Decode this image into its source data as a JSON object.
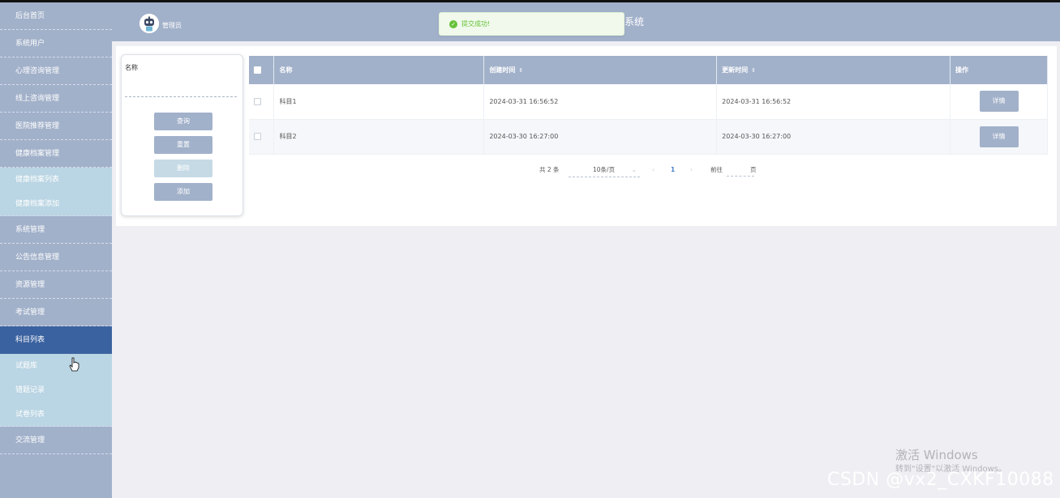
{
  "sidebar": {
    "items": [
      {
        "label": "后台首页",
        "type": "item"
      },
      {
        "label": "系统用户",
        "type": "item"
      },
      {
        "label": "心理咨询管理",
        "type": "item"
      },
      {
        "label": "线上咨询管理",
        "type": "item"
      },
      {
        "label": "医院推荐管理",
        "type": "item"
      },
      {
        "label": "健康档案管理",
        "type": "item"
      },
      {
        "label": "健康档案列表",
        "type": "sub"
      },
      {
        "label": "健康档案添加",
        "type": "sub"
      },
      {
        "label": "系统管理",
        "type": "item"
      },
      {
        "label": "公告信息管理",
        "type": "item"
      },
      {
        "label": "资源管理",
        "type": "item"
      },
      {
        "label": "考试管理",
        "type": "item"
      },
      {
        "label": "科目列表",
        "type": "active"
      },
      {
        "label": "试题库",
        "type": "sub"
      },
      {
        "label": "错题记录",
        "type": "sub"
      },
      {
        "label": "试卷列表",
        "type": "sub"
      },
      {
        "label": "交流管理",
        "type": "item"
      }
    ]
  },
  "header": {
    "admin_label": "管理员",
    "title_visible": "系统"
  },
  "toast": {
    "message": "提交成功!",
    "color": "#67c23a"
  },
  "search": {
    "name_label": "名称",
    "name_value": "",
    "buttons": {
      "query": "查询",
      "reset": "重置",
      "delete": "删除",
      "add": "添加"
    }
  },
  "table": {
    "headers": {
      "name": "名称",
      "created": "创建时间",
      "updated": "更新时间",
      "actions": "操作"
    },
    "rows": [
      {
        "name": "科目1",
        "created": "2024-03-31 16:56:52",
        "updated": "2024-03-31 16:56:52",
        "action": "详情"
      },
      {
        "name": "科目2",
        "created": "2024-03-30 16:27:00",
        "updated": "2024-03-30 16:27:00",
        "action": "详情"
      }
    ]
  },
  "pagination": {
    "total": "共 2 条",
    "page_size": "10条/页",
    "current_page": "1",
    "goto_label": "前往",
    "page_unit": "页"
  },
  "watermark": {
    "activate_title": "激活 Windows",
    "activate_hint": "转到\"设置\"以激活 Windows。",
    "csdn": "CSDN @vx2_CXKF10088"
  },
  "colors": {
    "sidebar": "#a2b1ca",
    "sidebar_active": "#3b62a0",
    "sidebar_sub": "#bad5e3",
    "header": "#a2b1ca",
    "success": "#67c23a"
  }
}
